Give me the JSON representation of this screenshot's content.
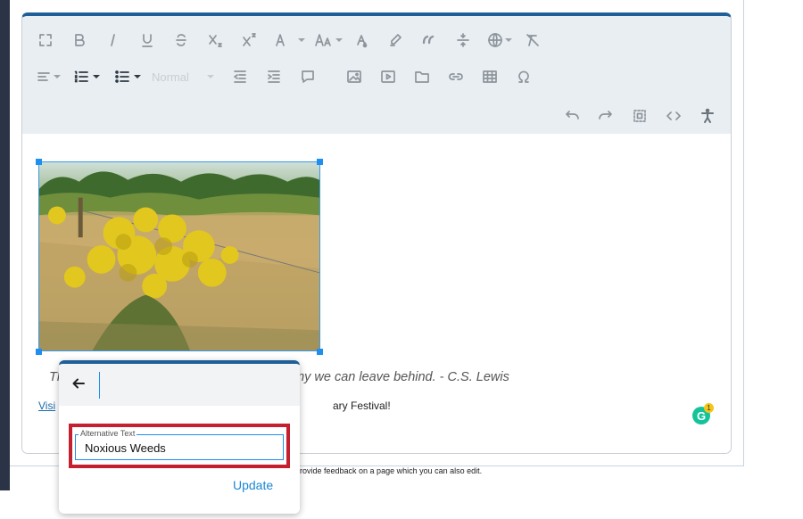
{
  "toolbar": {
    "row1": [
      {
        "name": "fullscreen-icon"
      },
      {
        "name": "bold-icon"
      },
      {
        "name": "italic-icon"
      },
      {
        "name": "underline-icon"
      },
      {
        "name": "strikethrough-icon"
      },
      {
        "name": "subscript-icon"
      },
      {
        "name": "superscript-icon"
      },
      {
        "name": "font-family-icon"
      },
      {
        "name": "font-size-icon"
      },
      {
        "name": "text-color-icon"
      },
      {
        "name": "highlight-icon"
      },
      {
        "name": "blockquote-icon"
      },
      {
        "name": "line-height-icon"
      },
      {
        "name": "language-icon"
      },
      {
        "name": "clear-formatting-icon"
      }
    ],
    "format_placeholder": "Normal",
    "row3": [
      {
        "name": "undo-icon"
      },
      {
        "name": "redo-icon"
      },
      {
        "name": "select-all-icon"
      },
      {
        "name": "code-view-icon"
      },
      {
        "name": "accessibility-icon"
      }
    ]
  },
  "content": {
    "quote_visible": "Th",
    "quote_tail": "any we can leave behind. - C.S. Lewis",
    "visit_text": "Visi",
    "visit_tail": "ary Festival!",
    "grammarly_letter": "G",
    "grammarly_count": "1"
  },
  "footer_note": "rovide feedback on a page which you can also edit.",
  "popup": {
    "legend": "Alternative Text",
    "alt_value": "Noxious Weeds",
    "update_label": "Update"
  },
  "colors": {
    "accent": "#1e5f99",
    "link": "#1a86d6",
    "highlight_box": "#c4202f"
  }
}
